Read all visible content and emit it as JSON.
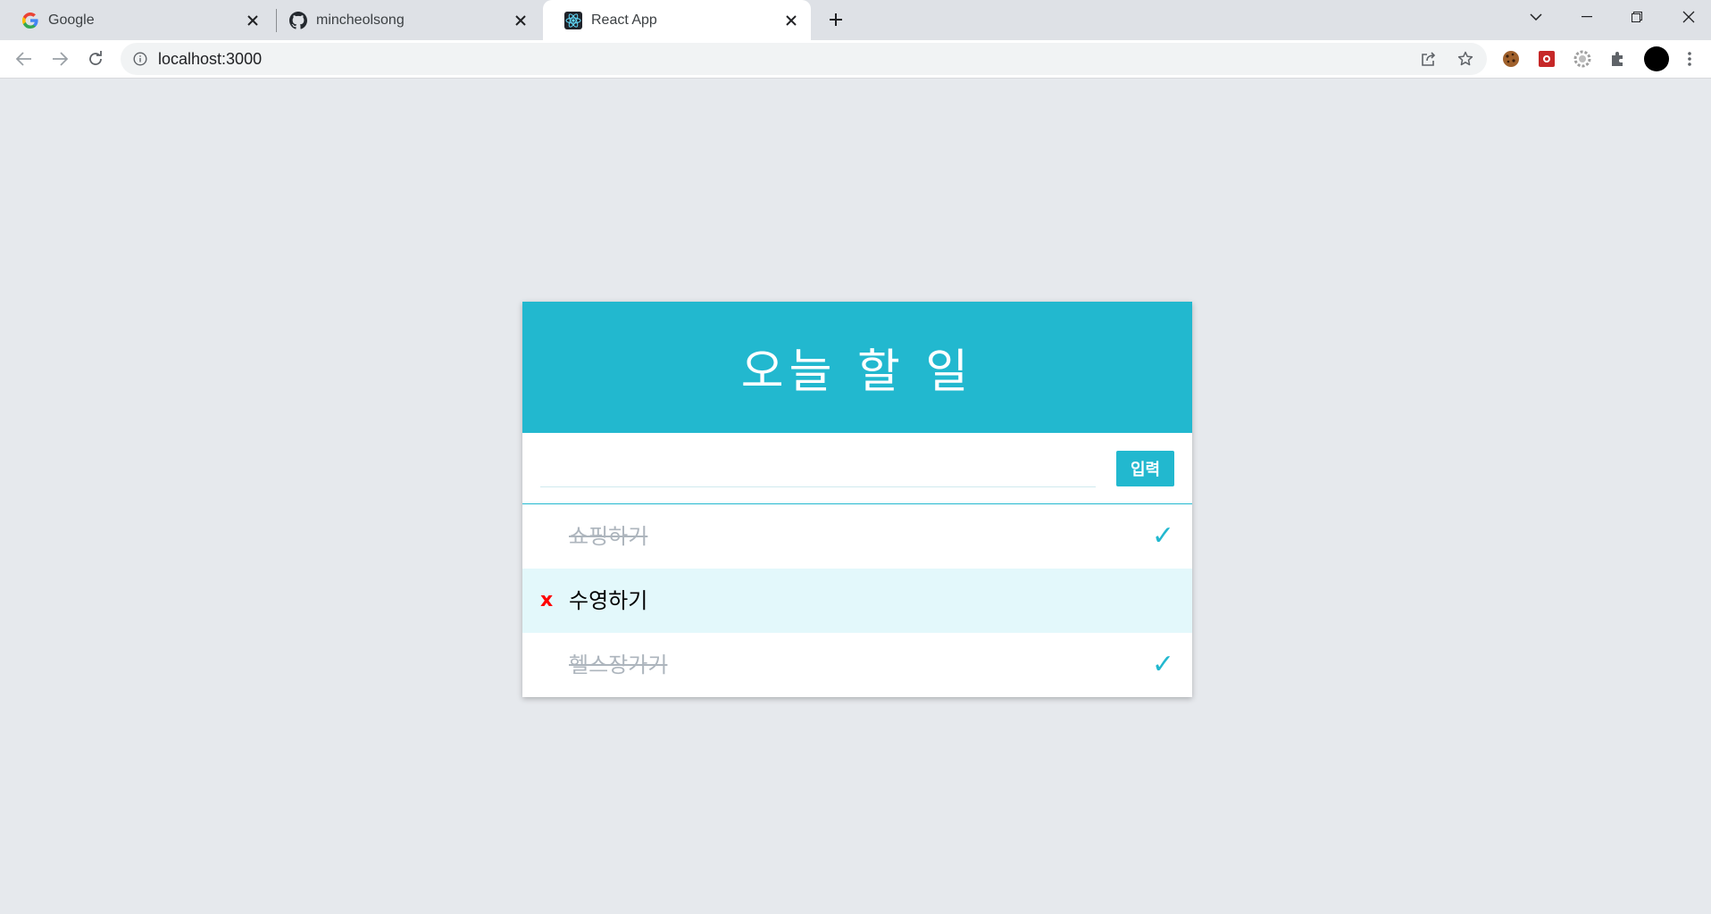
{
  "browser": {
    "tabs": [
      {
        "title": "Google",
        "icon": "google-icon",
        "active": false
      },
      {
        "title": "mincheolsong",
        "icon": "github-icon",
        "active": false
      },
      {
        "title": "React App",
        "icon": "react-icon",
        "active": true
      }
    ],
    "url": "localhost:3000"
  },
  "app": {
    "title": "오늘 할 일",
    "submit_label": "입력",
    "input_value": "",
    "remove_label": "x",
    "check_mark": "✓",
    "accent_color": "#22b8cf",
    "items": [
      {
        "text": "쇼핑하기",
        "done": true
      },
      {
        "text": "수영하기",
        "done": false
      },
      {
        "text": "헬스장가기",
        "done": true
      }
    ]
  }
}
